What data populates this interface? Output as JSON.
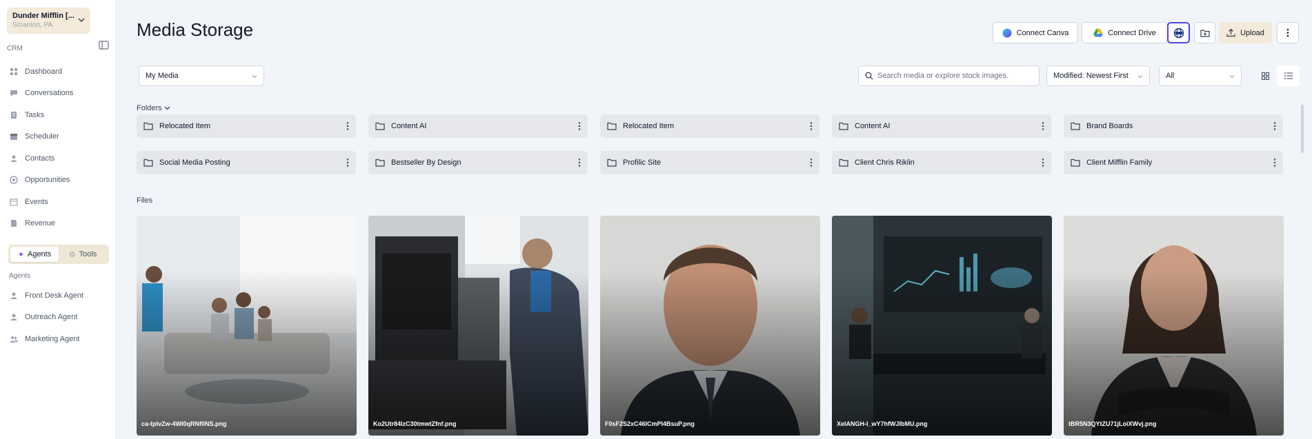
{
  "sidebar": {
    "account_name": "Dunder Mifflin [...",
    "account_location": "Scranton, PA",
    "section_label": "CRM",
    "nav": [
      {
        "label": "Dashboard",
        "icon": "dashboard-icon"
      },
      {
        "label": "Conversations",
        "icon": "chat-icon"
      },
      {
        "label": "Tasks",
        "icon": "task-icon"
      },
      {
        "label": "Scheduler",
        "icon": "calendar-icon"
      },
      {
        "label": "Contacts",
        "icon": "person-icon"
      },
      {
        "label": "Opportunities",
        "icon": "target-icon"
      },
      {
        "label": "Events",
        "icon": "events-icon"
      },
      {
        "label": "Revenue",
        "icon": "document-icon"
      }
    ],
    "tabs": {
      "agents": "Agents",
      "tools": "Tools",
      "active": "agents"
    },
    "agents_label": "Agents",
    "agents": [
      {
        "label": "Front Desk Agent",
        "icon": "agent-icon"
      },
      {
        "label": "Outreach Agent",
        "icon": "agent-icon"
      },
      {
        "label": "Marketing Agent",
        "icon": "group-icon"
      }
    ]
  },
  "header": {
    "title": "Media Storage",
    "connect_canva": "Connect Canva",
    "connect_drive": "Connect Drive",
    "upload": "Upload"
  },
  "toolbar": {
    "media_source": "My Media",
    "search_placeholder": "Search media or explore stock images.",
    "sort": "Modified: Newest First",
    "filter": "All",
    "active_view": "grid"
  },
  "folders_label": "Folders",
  "folders": [
    "Relocated Item",
    "Content AI",
    "Relocated Item",
    "Content AI",
    "Brand Boards",
    "Social Media Posting",
    "Bestseller By Design",
    "Profilic Site",
    "Client Chris Riklin",
    "Client Mifflin Family"
  ],
  "files_label": "Files",
  "files": [
    {
      "name": "ca-tpIvZw-4WI0qRNf0NS.png"
    },
    {
      "name": "Ko2Utr84IzC30tmwtZfnf.png"
    },
    {
      "name": "F0sF2S2xC46ICmPI4BsuP.png"
    },
    {
      "name": "XeIANGH-I_wY7hfWJIbMU.png"
    },
    {
      "name": "tBR5N3QYtZU71jLoiXWvj.png"
    }
  ],
  "colors": {
    "accent": "#4f46e5",
    "upload_bg": "#f3ead9"
  }
}
